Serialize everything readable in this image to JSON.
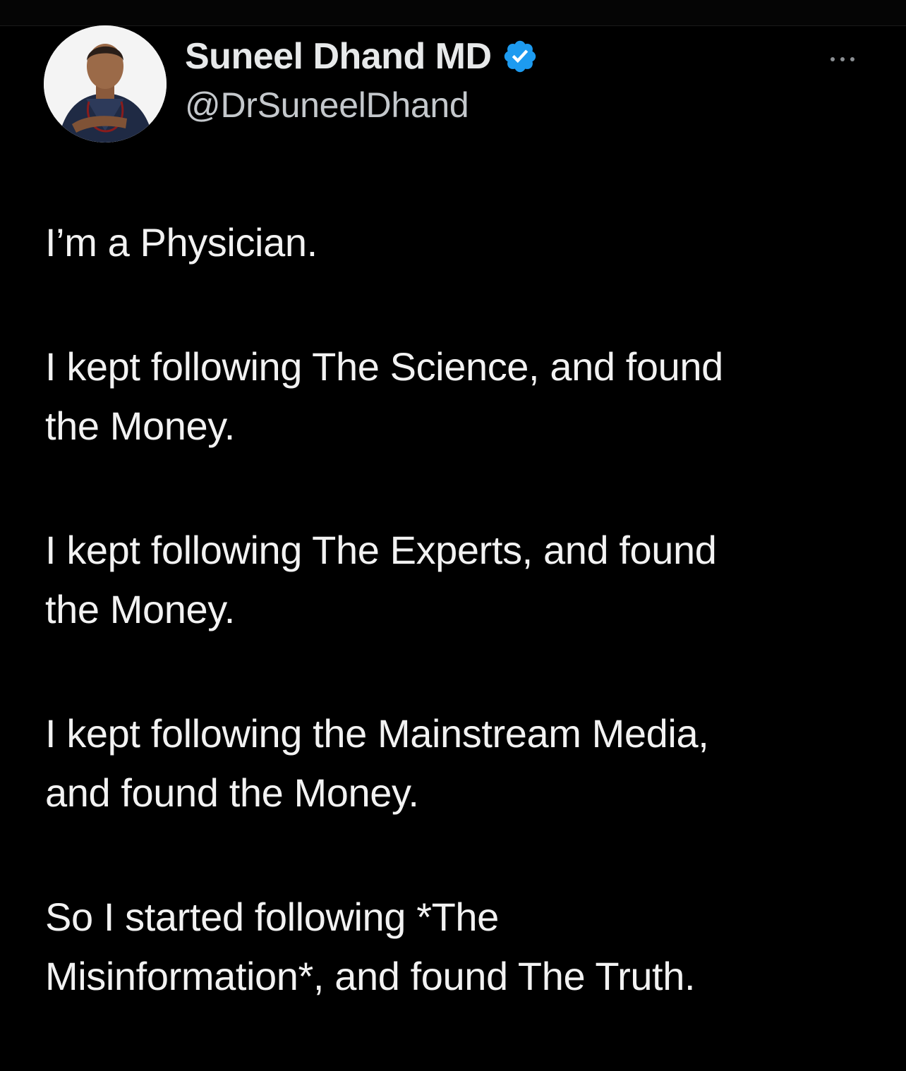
{
  "tweet": {
    "author": {
      "display_name": "Suneel Dhand MD",
      "handle": "@DrSuneelDhand",
      "verified": true,
      "verified_color": "#1d9bf0",
      "avatar_icon": "profile-photo"
    },
    "more_icon": "ellipsis-icon",
    "paragraphs": [
      "I’m a Physician.",
      "I kept following The Science, and found\nthe Money.",
      "I kept following The Experts, and found\nthe Money.",
      "I kept following the Mainstream Media,\nand found the Money.",
      "So I started following *The\nMisinformation*, and found The Truth."
    ]
  },
  "colors": {
    "background": "#000000",
    "text_primary": "#e7e9ea",
    "text_secondary": "#c4c8cc"
  }
}
